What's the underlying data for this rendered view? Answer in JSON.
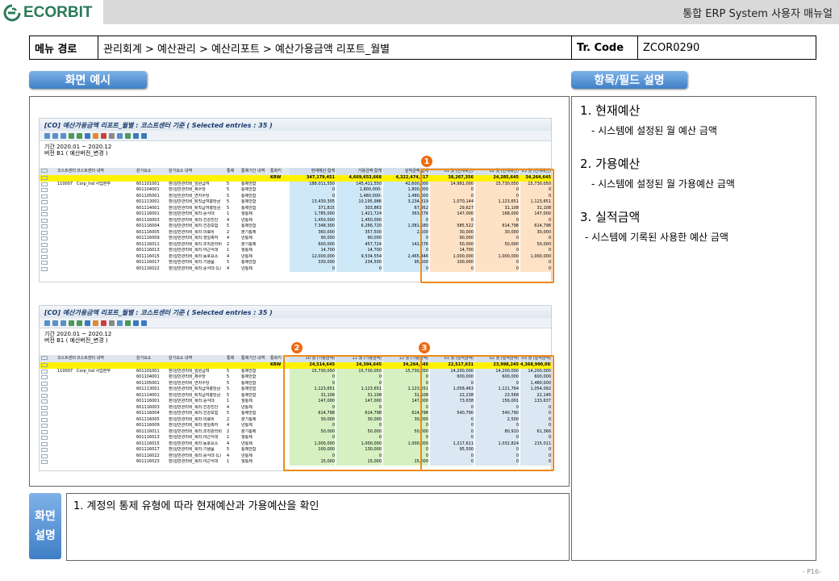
{
  "header": {
    "logo_text": "ECORBIT",
    "doc_title": "통합 ERP System 사용자 매뉴얼"
  },
  "path": {
    "label": "메뉴 경로",
    "value": "관리회계 > 예산관리 > 예산리포트 > 예산가용금액 리포트_월별",
    "tcode_label": "Tr. Code",
    "tcode": "ZCOR0290"
  },
  "sections": {
    "screen_example": "화면 예시",
    "field_desc": "항목/필드 설명"
  },
  "fields": [
    {
      "title": "1.  현재예산",
      "desc": "- 시스템에 설정된 월 예산 금액"
    },
    {
      "title": "2.  가용예산",
      "desc": "- 시스템에 설정된 월 가용예산 금액"
    },
    {
      "title": "3.  실적금액",
      "desc": "- 시스템에 기록된 사용한 예산 금액"
    }
  ],
  "screen_desc": {
    "label1": "화면",
    "label2": "설명",
    "text": "1.  계정의 통제 유형에 따라 현재예산과 가용예산을 확인"
  },
  "page_number": "- P16-",
  "badges": [
    "1",
    "2",
    "3"
  ],
  "colors": {
    "highlight": "#f08a18",
    "total_row": "#fff200",
    "pill": "#3f7fc6",
    "budget_col": "#fde2c6",
    "avail_col": "#d6f0c2",
    "actual_col": "#dbe8f4",
    "summary_col": "#cfe8f7"
  },
  "report1": {
    "title": "[CO] 예산가용금액 리포트_월별 : 코스트센터 기준 ( Selected entries : 35 )",
    "period": "기간  2020.01 ~ 2020.12",
    "version": "버전  B1 ( 예산버전_변경 )",
    "headers": [
      "코스트센터",
      "코스트센터 내역",
      "원가요소",
      "원가요소 내역",
      "통제",
      "통제기간 내역",
      "통화키",
      "현재예산 합계",
      "가용금액 합계",
      "실적금액 합계",
      "01 월 (현재예산)",
      "02 월 (현재예산)",
      "03 월 (현재예산)"
    ],
    "total": [
      "",
      "",
      "",
      "",
      "",
      "",
      "KRW",
      "347,179,451",
      "4,669,653,668",
      "4,322,474,217",
      "38,267,356",
      "24,285,645",
      "34,264,645"
    ],
    "rows": [
      [
        "110007",
        "Corp_Ind 사업본부",
        "601101001",
        "판)일반관리비_임원급여",
        "5",
        "통제안함",
        "",
        "188,011,550",
        "145,411,550",
        "42,600,000",
        "14,981,000",
        "15,730,050",
        "15,730,050"
      ],
      [
        "",
        "",
        "601104001",
        "판)일반관리비_제수당",
        "5",
        "통제안함",
        "",
        "0",
        "1,800,000-",
        "1,800,000",
        "0",
        "0",
        "0"
      ],
      [
        "",
        "",
        "601105001",
        "판)일반관리비_연차수당",
        "5",
        "통제안함",
        "",
        "0",
        "1,480,000-",
        "1,480,000",
        "0",
        "0",
        "0"
      ],
      [
        "",
        "",
        "601113001",
        "판)일반관리비_퇴직급여충당금",
        "5",
        "통제안함",
        "",
        "13,430,305",
        "10,195,986",
        "3,234,319",
        "1,070,144",
        "1,123,651",
        "1,123,651"
      ],
      [
        "",
        "",
        "601114001",
        "판)일반관리비_퇴직급여충당금",
        "5",
        "통제안함",
        "",
        "371,815",
        "303,863",
        "67,952",
        "29,627",
        "31,108",
        "31,108"
      ],
      [
        "",
        "",
        "601116001",
        "판)일반관리비_복리:중식대",
        "1",
        "월통제",
        "",
        "1,785,000",
        "1,421,724",
        "363,276",
        "147,000",
        "168,000",
        "147,000"
      ],
      [
        "",
        "",
        "601116003",
        "판)일반관리비_복리:건강진단",
        "4",
        "년통제",
        "",
        "1,450,000",
        "1,450,000",
        "0",
        "0",
        "0",
        "0"
      ],
      [
        "",
        "",
        "601116004",
        "판)일반관리비_복리:건강보험",
        "5",
        "통제안함",
        "",
        "7,348,300",
        "6,266,720",
        "1,081,580",
        "585,522",
        "614,798",
        "614,798"
      ],
      [
        "",
        "",
        "601116005",
        "판)일반관리비_복리:의료비",
        "2",
        "분기통제",
        "",
        "360,000",
        "357,500",
        "2,500",
        "30,000",
        "30,000",
        "30,000"
      ],
      [
        "",
        "",
        "601116009",
        "판)일반관리비_복리:생일축하",
        "4",
        "년통제",
        "",
        "90,000",
        "90,000",
        "0",
        "90,000",
        "0",
        "0"
      ],
      [
        "",
        "",
        "601116011",
        "판)일반관리비_복리:조직관리비",
        "2",
        "분기통제",
        "",
        "600,000",
        "457,724",
        "142,276",
        "50,000",
        "50,000",
        "50,000"
      ],
      [
        "",
        "",
        "601116013",
        "판)일반관리비_복리:야근식대",
        "1",
        "월통제",
        "",
        "14,700",
        "14,700",
        "0",
        "14,700",
        "0",
        "0"
      ],
      [
        "",
        "",
        "601116015",
        "판)일반관리비_복리:동호요소",
        "4",
        "년통제",
        "",
        "12,000,000",
        "9,534,554",
        "2,465,446",
        "1,000,000",
        "1,000,000",
        "1,000,000"
      ],
      [
        "",
        "",
        "601116017",
        "판)일반관리비_복리:기념품",
        "5",
        "통제안함",
        "",
        "330,000",
        "234,500",
        "95,500",
        "100,000",
        "0",
        "0"
      ],
      [
        "",
        "",
        "601116022",
        "판)일반관리비_복리:중식대 (L)",
        "4",
        "년통제",
        "",
        "0",
        "0",
        "0",
        "0",
        "0",
        "0"
      ]
    ]
  },
  "report2": {
    "title": "[CO] 예산가용금액 리포트_월별 : 코스트센터 기준 ( Selected entries : 35 )",
    "period": "기간  2020.01 ~ 2020.12",
    "version": "버전  B1 ( 예산버전_변경 )",
    "headers": [
      "코스트센터",
      "코스트센터 내역",
      "원가요소",
      "원가요소 내역",
      "통제",
      "통제기간 내역",
      "통화키",
      "10 월 (가용금액)",
      "11 월 (가용금액)",
      "12 월 (가용금액)",
      "01 월 (실적금액)",
      "02 월 (실적금액)",
      "03 월 (실적금액)"
    ],
    "total": [
      "",
      "",
      "",
      "",
      "",
      "",
      "KRW",
      "24,514,645",
      "24,394,645",
      "34,264,645",
      "22,517,631",
      "23,998,245",
      "4,368,990,093-"
    ],
    "rows": [
      [
        "110007",
        "Corp_Ind 사업본부",
        "601101001",
        "판)일반관리비_임원급여",
        "5",
        "통제안함",
        "",
        "15,730,050",
        "15,730,050",
        "15,730,050",
        "14,200,000",
        "14,200,000",
        "14,200,000"
      ],
      [
        "",
        "",
        "601104001",
        "판)일반관리비_제수당",
        "5",
        "통제안함",
        "",
        "0",
        "0",
        "0",
        "600,000",
        "600,000",
        "600,000"
      ],
      [
        "",
        "",
        "601105001",
        "판)일반관리비_연차수당",
        "5",
        "통제안함",
        "",
        "0",
        "0",
        "0",
        "0",
        "0",
        "1,480,000"
      ],
      [
        "",
        "",
        "601113001",
        "판)일반관리비_퇴직급여충당금",
        "5",
        "통제안함",
        "",
        "1,123,651",
        "1,123,651",
        "1,123,651",
        "1,058,463",
        "1,121,764",
        "1,054,092"
      ],
      [
        "",
        "",
        "601114001",
        "판)일반관리비_퇴직급여충당금",
        "5",
        "통제안함",
        "",
        "31,108",
        "31,108",
        "31,108",
        "22,238",
        "23,568",
        "22,146"
      ],
      [
        "",
        "",
        "601116001",
        "판)일반관리비_복리:중식대",
        "1",
        "월통제",
        "",
        "147,000",
        "147,000",
        "147,000",
        "73,638",
        "156,001",
        "133,637"
      ],
      [
        "",
        "",
        "601116003",
        "판)일반관리비_복리:건강진단",
        "4",
        "년통제",
        "",
        "0",
        "0",
        "0",
        "0",
        "0",
        "0"
      ],
      [
        "",
        "",
        "601116004",
        "판)일반관리비_복리:건강보험",
        "5",
        "통제안함",
        "",
        "614,798",
        "614,798",
        "614,798",
        "540,790",
        "540,790",
        "0"
      ],
      [
        "",
        "",
        "601116005",
        "판)일반관리비_복리:의료비",
        "2",
        "분기통제",
        "",
        "30,000",
        "30,000",
        "30,000",
        "0",
        "2,500",
        "0"
      ],
      [
        "",
        "",
        "601116009",
        "판)일반관리비_복리:생일축하",
        "4",
        "년통제",
        "",
        "0",
        "0",
        "0",
        "0",
        "0",
        "0"
      ],
      [
        "",
        "",
        "601116011",
        "판)일반관리비_복리:조직관리비",
        "2",
        "분기통제",
        "",
        "50,000",
        "50,000",
        "50,000",
        "0",
        "80,910",
        "61,366"
      ],
      [
        "",
        "",
        "601116013",
        "판)일반관리비_복리:야근식대",
        "1",
        "월통제",
        "",
        "0",
        "0",
        "0",
        "0",
        "0",
        "0"
      ],
      [
        "",
        "",
        "601116015",
        "판)일반관리비_복리:동호요소",
        "4",
        "년통제",
        "",
        "1,000,000",
        "1,000,000",
        "1,000,000",
        "1,217,611",
        "1,032,824",
        "215,011"
      ],
      [
        "",
        "",
        "601116017",
        "판)일반관리비_복리:기념품",
        "5",
        "통제안함",
        "",
        "100,000",
        "130,000",
        "0",
        "95,500",
        "0",
        "0"
      ],
      [
        "",
        "",
        "601116022",
        "판)일반관리비_복리:중식대 (L)",
        "4",
        "년통제",
        "",
        "0",
        "0",
        "0",
        "0",
        "0",
        "0"
      ],
      [
        "",
        "",
        "601116023",
        "판)일반관리비_복리:야근식대",
        "1",
        "월통제",
        "",
        "15,000",
        "15,000",
        "15,000",
        "0",
        "0",
        "0"
      ]
    ]
  }
}
